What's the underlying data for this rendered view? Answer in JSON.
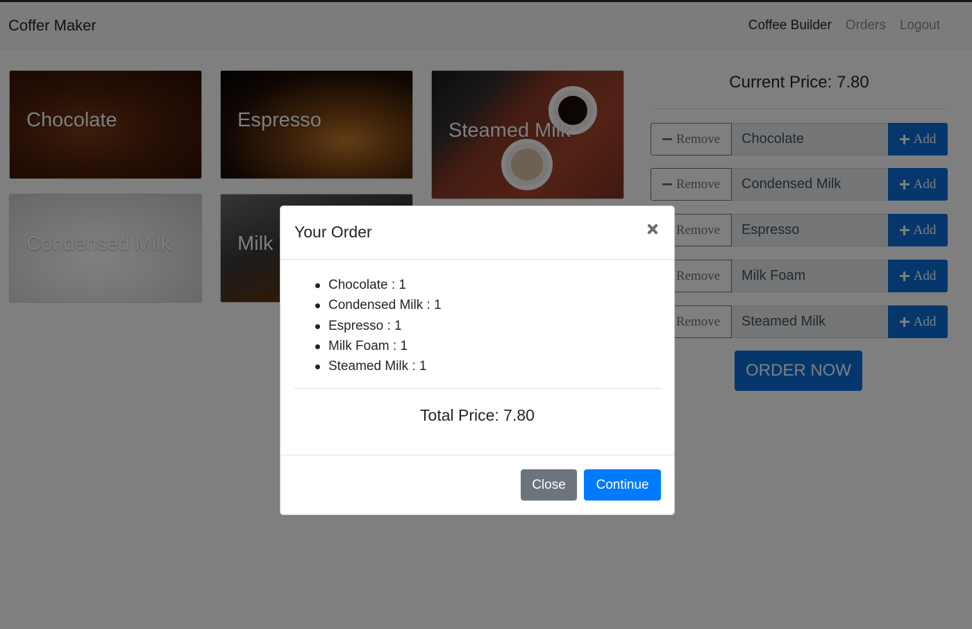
{
  "navbar": {
    "brand": "Coffer Maker",
    "links": [
      {
        "label": "Coffee Builder",
        "active": true
      },
      {
        "label": "Orders",
        "active": false
      },
      {
        "label": "Logout",
        "active": false
      }
    ]
  },
  "tiles": [
    {
      "label": "Chocolate"
    },
    {
      "label": "Espresso"
    },
    {
      "label": "Steamed Milk"
    },
    {
      "label": "Condensed Milk"
    },
    {
      "label": "Milk"
    }
  ],
  "builder": {
    "current_price": "Current Price: 7.80",
    "remove_label": "Remove",
    "add_label": "Add",
    "ingredients": [
      {
        "name": "Chocolate"
      },
      {
        "name": "Condensed Milk"
      },
      {
        "name": "Espresso"
      },
      {
        "name": "Milk Foam"
      },
      {
        "name": "Steamed Milk"
      }
    ],
    "order_now": "ORDER NOW"
  },
  "modal": {
    "title": "Your Order",
    "items": [
      {
        "text": "Chocolate : 1"
      },
      {
        "text": "Condensed Milk : 1"
      },
      {
        "text": "Espresso : 1"
      },
      {
        "text": "Milk Foam : 1"
      },
      {
        "text": "Steamed Milk : 1"
      }
    ],
    "total": "Total Price: 7.80",
    "close_button": "Close",
    "continue_button": "Continue"
  },
  "colors": {
    "primary": "#007bff",
    "secondary": "#6c757d",
    "backdrop": "rgba(0,0,0,0.5)"
  }
}
